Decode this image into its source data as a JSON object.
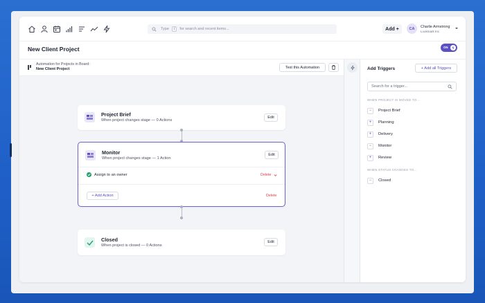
{
  "search": {
    "prefix": "Type",
    "key": "/",
    "suffix": "for search and recent items..."
  },
  "header": {
    "add_label": "Add",
    "avatar_initials": "CA",
    "user_name": "Charlie Armstrong",
    "user_org": "Lookmark Inc"
  },
  "page": {
    "title": "New Client Project",
    "toggle_label": "ON"
  },
  "infobar": {
    "line1": "Automation for Projects in Board:",
    "line2": "New Client Project",
    "test_label": "Test this Automation"
  },
  "cards": {
    "brief": {
      "title": "Project Brief",
      "subtitle": "When project changes stage — 0 Actions",
      "edit": "Edit"
    },
    "monitor": {
      "title": "Monitor",
      "subtitle": "When project changes stage — 1 Action",
      "edit": "Edit",
      "action_label": "Assign to an owner",
      "action_delete": "Delete",
      "add_action": "+ Add Action",
      "delete": "Delete"
    },
    "closed": {
      "title": "Closed",
      "subtitle": "When project is closed — 0 Actions",
      "edit": "Edit"
    }
  },
  "panel": {
    "title": "Add Triggers",
    "add_all": "+ Add all Triggers",
    "search_placeholder": "Search for a trigger...",
    "section1": "WHEN PROJECT IS MOVED TO...",
    "stage_triggers": [
      {
        "sign": "−",
        "label": "Project Brief"
      },
      {
        "sign": "+",
        "label": "Planning"
      },
      {
        "sign": "+",
        "label": "Delivery"
      },
      {
        "sign": "−",
        "label": "Monitor"
      },
      {
        "sign": "+",
        "label": "Review"
      }
    ],
    "section2": "WHEN STATUS CHANGES TO...",
    "status_triggers": [
      {
        "sign": "−",
        "label": "Closed"
      }
    ]
  },
  "colors": {
    "accent": "#5b4fc4",
    "danger": "#d64545",
    "success": "#22a06b",
    "background": "#1e5fc7"
  }
}
